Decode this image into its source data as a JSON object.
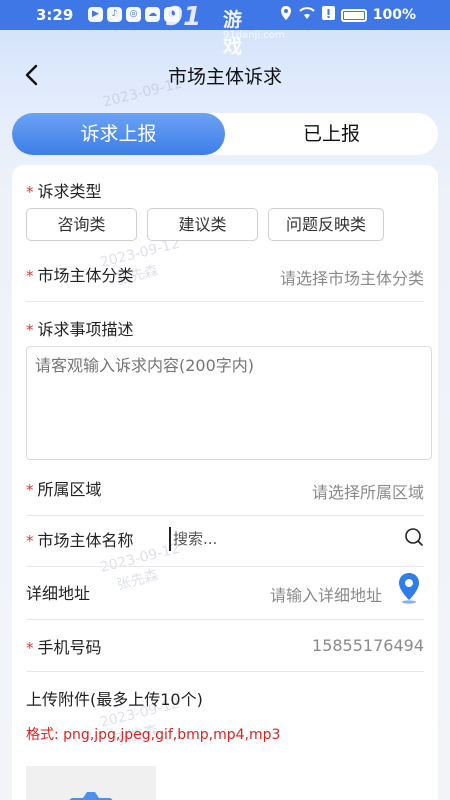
{
  "status": {
    "time": "3:29",
    "battery": "100%",
    "app_icons": [
      "video-app-icon",
      "music-app-icon",
      "browser-app-icon",
      "cloud-app-icon",
      "weibo-app-icon"
    ]
  },
  "watermark_logo": {
    "number": "91",
    "name": "游戏",
    "site": "91danji.com"
  },
  "header": {
    "title": "市场主体诉求"
  },
  "tabs": [
    {
      "label": "诉求上报",
      "active": true
    },
    {
      "label": "已上报",
      "active": false
    }
  ],
  "form": {
    "type": {
      "required_mark": "*",
      "label": "诉求类型",
      "options": [
        "咨询类",
        "建议类",
        "问题反映类"
      ]
    },
    "category": {
      "required_mark": "*",
      "label": "市场主体分类",
      "placeholder": "请选择市场主体分类"
    },
    "description": {
      "required_mark": "*",
      "label": "诉求事项描述",
      "placeholder": "请客观输入诉求内容(200字内)"
    },
    "region": {
      "required_mark": "*",
      "label": "所属区域",
      "placeholder": "请选择所属区域"
    },
    "entity_name": {
      "required_mark": "*",
      "label": "市场主体名称",
      "placeholder": "搜索..."
    },
    "address": {
      "label": "详细地址",
      "placeholder": "请输入详细地址"
    },
    "phone": {
      "required_mark": "*",
      "label": "手机号码",
      "value": "15855176494"
    },
    "attachments": {
      "label": "上传附件(最多上传10个)",
      "format": "格式:  png,jpg,jpeg,gif,bmp,mp4,mp3"
    }
  },
  "watermark": {
    "date": "2023-09-12",
    "name": "张先森"
  },
  "colors": {
    "accent": "#3f7ee8",
    "required": "#e43535",
    "status_bar": "#3f78e6"
  }
}
